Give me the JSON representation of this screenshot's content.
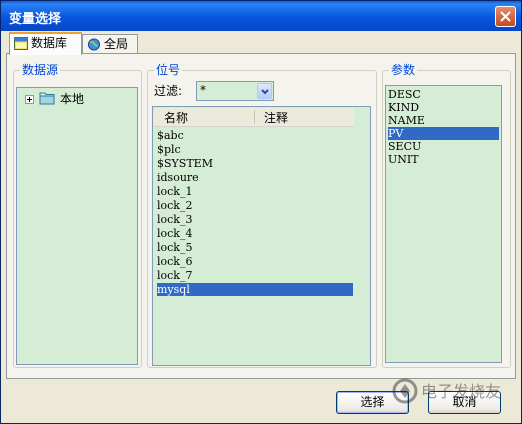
{
  "window": {
    "title": "变量选择"
  },
  "tabs": [
    {
      "label": "数据库",
      "icon": "database-icon",
      "active": true
    },
    {
      "label": "全局",
      "icon": "globe-icon",
      "active": false
    }
  ],
  "datasource": {
    "group_label": "数据源",
    "tree": [
      {
        "label": "本地",
        "icon": "folder-icon",
        "expander": "+"
      }
    ]
  },
  "tags": {
    "group_label": "位号",
    "filter_label": "过滤:",
    "filter_value": "*",
    "columns": [
      "名称",
      "注释"
    ],
    "items": [
      "$abc",
      "$plc",
      "$SYSTEM",
      "idsoure",
      "lock_1",
      "lock_2",
      "lock_3",
      "lock_4",
      "lock_5",
      "lock_6",
      "lock_7",
      "mysql"
    ],
    "selected_index": 11
  },
  "params": {
    "group_label": "参数",
    "items": [
      "DESC",
      "KIND",
      "NAME",
      "PV",
      "SECU",
      "UNIT"
    ],
    "selected_index": 3
  },
  "buttons": {
    "ok_label": "选择",
    "cancel_label": "取消"
  },
  "watermark": {
    "text": "电子发烧友"
  },
  "colors": {
    "accent": "#0046d5",
    "selection": "#316ac5",
    "panel_bg": "#d5ecd5",
    "titlebar": "#0855dd"
  }
}
